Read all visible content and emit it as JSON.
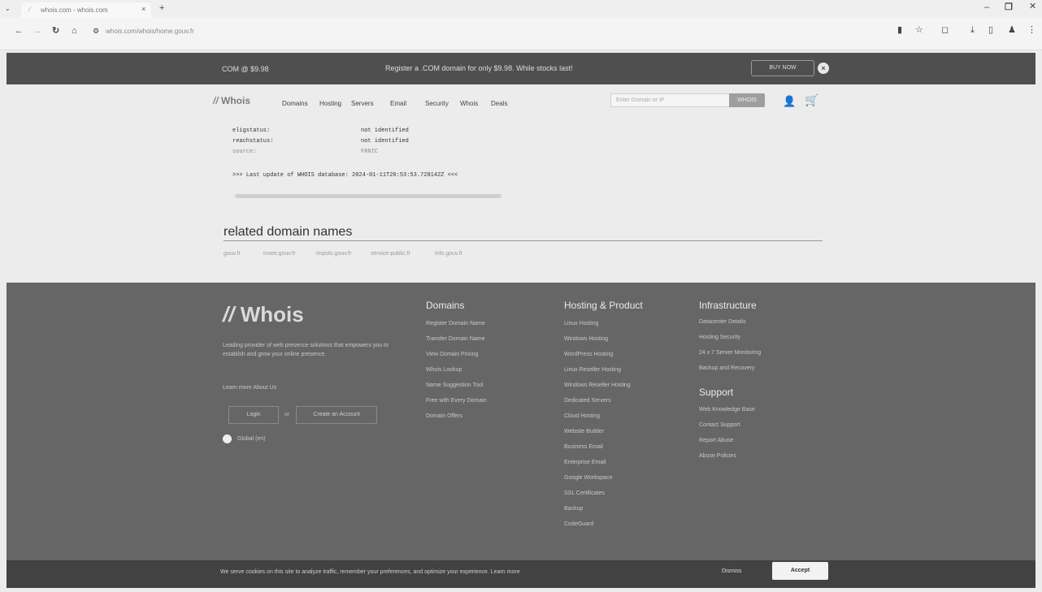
{
  "browser": {
    "tab_title": "whois.com - whois.com",
    "url": "whois.com/whois/home.gouv.fr"
  },
  "promo": {
    "price_tag": "COM @ $9.98",
    "message": "Register a .COM domain for only $9.98. While stocks last!",
    "buy_now": "BUY NOW"
  },
  "nav": {
    "logo": "Whois",
    "items": [
      "Domains",
      "Hosting",
      "Servers",
      "Email",
      "Security",
      "Whois",
      "Deals"
    ],
    "search_placeholder": "Enter Domain or IP",
    "search_button": "WHOIS"
  },
  "whois": {
    "rows": [
      {
        "key": "eligstatus:",
        "value": "not identified"
      },
      {
        "key": "reachstatus:",
        "value": "not identified"
      },
      {
        "key": "source:",
        "value": "FRNIC"
      }
    ],
    "last_update": ">>> Last update of WHOIS database: 2024-01-11T20:53:53.728142Z <<<"
  },
  "related": {
    "title": "related domain names",
    "items": [
      "gouv.fr",
      "insee.gouv.fr",
      "impots.gouv.fr",
      "service-public.fr",
      "info.gouv.fr"
    ]
  },
  "footer": {
    "logo": "Whois",
    "tagline": "Leading provider of web presence solutions that empowers you to establish and grow your online presence.",
    "learn_more": "Learn more About Us",
    "login": "Login",
    "or": "or",
    "create_account": "Create an Account",
    "country": "Global (en)",
    "columns": [
      {
        "title": "Domains",
        "links": [
          "Register Domain Name",
          "Transfer Domain Name",
          "View Domain Pricing",
          "Whois Lookup",
          "Name Suggestion Tool",
          "Free with Every Domain",
          "Domain Offers"
        ]
      },
      {
        "title": "Hosting & Product",
        "links": [
          "Linux Hosting",
          "Windows Hosting",
          "WordPress Hosting",
          "Linux Reseller Hosting",
          "Windows Reseller Hosting",
          "Dedicated Servers",
          "Cloud Hosting",
          "Website Builder",
          "Business Email",
          "Enterprise Email",
          "Google Workspace",
          "SSL Certificates",
          "Backup",
          "CodeGuard"
        ]
      },
      {
        "title": "Infrastructure",
        "links": [
          "Datacenter Details",
          "Hosting Security",
          "24 x 7 Server Monitoring",
          "Backup and Recovery"
        ]
      },
      {
        "title": "Support",
        "links": [
          "Web Knowledge Base",
          "Contact Support",
          "Report Abuse",
          "Abuse Policies"
        ]
      }
    ]
  },
  "cookie": {
    "text": "We serve cookies on this site to analyze traffic, remember your preferences, and optimize your experience. Learn more",
    "dismiss": "Dismiss",
    "accept": "Accept"
  }
}
